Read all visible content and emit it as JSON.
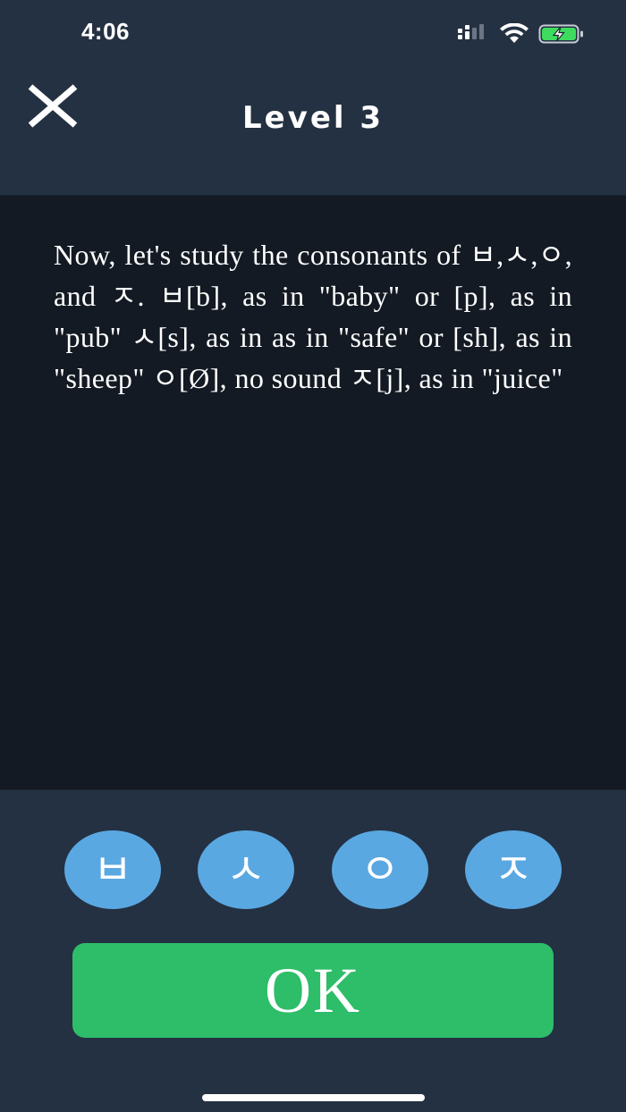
{
  "status_bar": {
    "time": "4:06"
  },
  "header": {
    "title": "Level 3",
    "close_icon": "close-icon"
  },
  "lesson": {
    "text": "Now, let's study the consonants of ㅂ,ㅅ,ㅇ, and ㅈ. ㅂ[b], as in \"baby\" or [p], as in \"pub\" ㅅ[s], as in as in \"safe\" or [sh], as in \"sheep\" ㅇ[Ø], no sound ㅈ[j], as in \"juice\""
  },
  "consonants": [
    {
      "label": "ㅂ"
    },
    {
      "label": "ㅅ"
    },
    {
      "label": "ㅇ"
    },
    {
      "label": "ㅈ"
    }
  ],
  "ok_button": {
    "label": "OK"
  },
  "colors": {
    "background": "#243142",
    "panel": "#131a23",
    "consonant_button": "#5aa8e2",
    "ok_button": "#2ebd69",
    "battery_charging": "#3ddc5f"
  },
  "icons": {
    "signal": "cellular-signal-icon",
    "wifi": "wifi-icon",
    "battery": "battery-charging-icon"
  }
}
